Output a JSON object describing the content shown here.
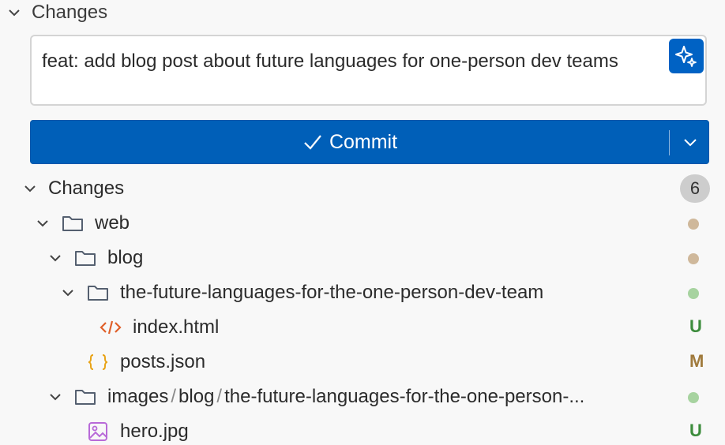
{
  "section": {
    "title": "Changes"
  },
  "message": {
    "text": "feat: add blog post about future languages for one-person dev teams"
  },
  "commit": {
    "label": "Commit"
  },
  "changes": {
    "title": "Changes",
    "count": "6",
    "items": [
      {
        "label": "web",
        "icon": "folder-icon",
        "decoration": "dot",
        "color": "#cfb89b"
      },
      {
        "label": "blog",
        "icon": "folder-icon",
        "decoration": "dot",
        "color": "#cfb89b"
      },
      {
        "label": "the-future-languages-for-the-one-person-dev-team",
        "icon": "folder-icon",
        "decoration": "dot",
        "color": "#a7d3a0"
      },
      {
        "label": "index.html",
        "icon": "html-file-icon",
        "status": "U",
        "color": "#3c8c3c"
      },
      {
        "label": "posts.json",
        "icon": "json-file-icon",
        "status": "M",
        "color": "#a07a3c"
      },
      {
        "label_parts": [
          "images",
          "blog",
          "the-future-languages-for-the-one-person-..."
        ],
        "icon": "folder-icon",
        "decoration": "dot",
        "color": "#a7d3a0"
      },
      {
        "label": "hero.jpg",
        "icon": "image-file-icon",
        "status": "U",
        "color": "#3c8c3c"
      }
    ]
  }
}
